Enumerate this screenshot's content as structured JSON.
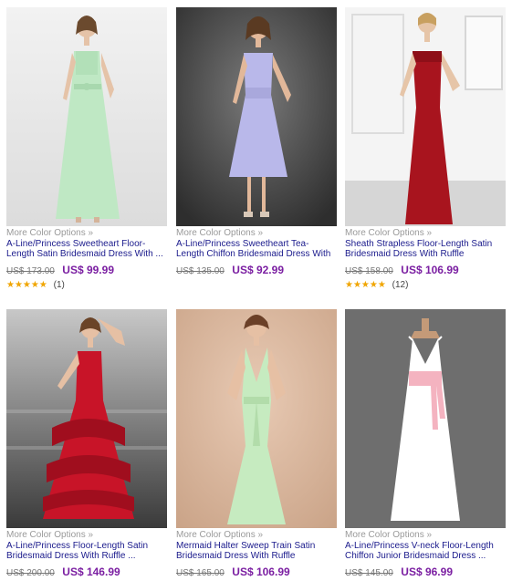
{
  "more_label": "More Color Options »",
  "currency_old": "US$",
  "products": [
    {
      "title": "A-Line/Princess Sweetheart Floor-Length Satin Bridesmaid Dress With ...",
      "old_price": "US$ 173.00",
      "new_price": "US$ 99.99",
      "stars": "★★★★★",
      "reviews": "(1)",
      "dress_color": "#bfe8c4",
      "bg_color": "#e9eaea"
    },
    {
      "title": "A-Line/Princess Sweetheart Tea-Length Chiffon Bridesmaid Dress With ...",
      "old_price": "US$ 135.00",
      "new_price": "US$ 92.99",
      "stars": "",
      "reviews": "",
      "dress_color": "#b9b8ea",
      "bg_color": "#4a4a4a"
    },
    {
      "title": "Sheath Strapless Floor-Length Satin Bridesmaid Dress With Ruffle",
      "old_price": "US$ 158.00",
      "new_price": "US$ 106.99",
      "stars": "★★★★★",
      "reviews": "(12)",
      "dress_color": "#a8141e",
      "bg_color": "#f2f2f2"
    },
    {
      "title": "A-Line/Princess Floor-Length Satin Bridesmaid Dress With Ruffle ...",
      "old_price": "US$ 200.00",
      "new_price": "US$ 146.99",
      "stars": "",
      "reviews": "",
      "dress_color": "#c81428",
      "bg_color": "#d8d8d8"
    },
    {
      "title": "Mermaid Halter Sweep Train Satin Bridesmaid Dress With Ruffle",
      "old_price": "US$ 165.00",
      "new_price": "US$ 106.99",
      "stars": "",
      "reviews": "",
      "dress_color": "#c6ebc0",
      "bg_color": "#d9b8a0"
    },
    {
      "title": "A-Line/Princess V-neck Floor-Length Chiffon Junior Bridesmaid Dress ...",
      "old_price": "US$ 145.00",
      "new_price": "US$ 96.99",
      "stars": "",
      "reviews": "",
      "dress_color": "#ffffff",
      "bg_color": "#6e6e6e"
    }
  ]
}
